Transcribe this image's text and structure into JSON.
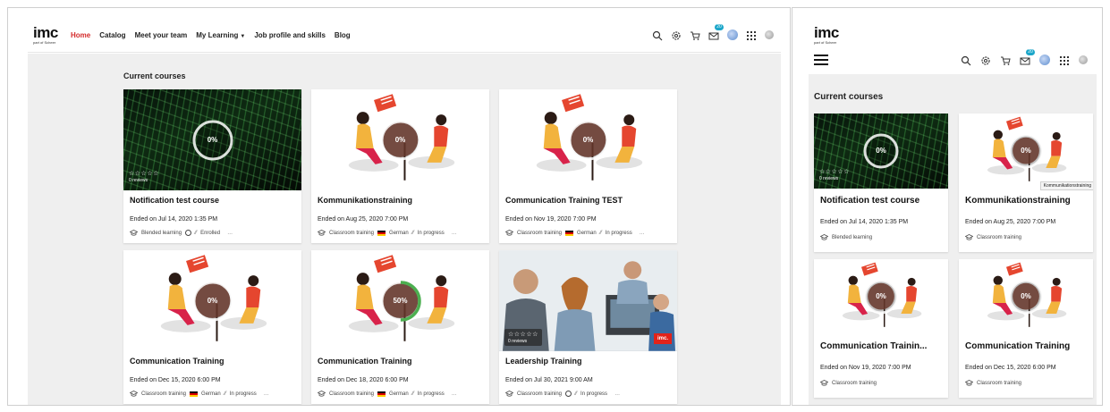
{
  "brand": {
    "logo": "imc",
    "logo_sub": "part of Scheer"
  },
  "nav": {
    "items": [
      {
        "label": "Home",
        "active": true
      },
      {
        "label": "Catalog"
      },
      {
        "label": "Meet your team"
      },
      {
        "label": "My Learning",
        "has_dropdown": true
      },
      {
        "label": "Job profile and skills"
      },
      {
        "label": "Blog"
      }
    ]
  },
  "toolbar": {
    "icons": [
      "search-icon",
      "settings-icon",
      "cart-icon",
      "mail-icon",
      "avatar",
      "apps-grid-icon",
      "profile-icon"
    ],
    "mail_badge": "20"
  },
  "colors": {
    "accent": "#d42b2b",
    "badge": "#1ba6c9",
    "page_bg": "#efefef",
    "progress_green": "#4caf50"
  },
  "section": {
    "title": "Current courses"
  },
  "courses": [
    {
      "title": "Notification test course",
      "ended": "Ended on Jul 14, 2020 1:35 PM",
      "type": "Blended learning",
      "language_icon": "globe-icon",
      "language": "",
      "status": "Enrolled",
      "progress": "0%",
      "progress_value": 0,
      "stars": "☆☆☆☆☆",
      "reviews": "0 reviews",
      "image": "matrix"
    },
    {
      "title": "Kommunikationstraining",
      "ended": "Ended on Aug 25, 2020 7:00 PM",
      "type": "Classroom training",
      "language_icon": "german-flag-icon",
      "language": "German",
      "status": "In progress",
      "progress": "0%",
      "progress_value": 0,
      "image": "illustration"
    },
    {
      "title": "Communication Training TEST",
      "ended": "Ended on Nov 19, 2020 7:00 PM",
      "type": "Classroom training",
      "language_icon": "german-flag-icon",
      "language": "German",
      "status": "In progress",
      "progress": "0%",
      "progress_value": 0,
      "image": "illustration"
    },
    {
      "title": "Communication Training",
      "ended": "Ended on Dec 15, 2020 6:00 PM",
      "type": "Classroom training",
      "language_icon": "german-flag-icon",
      "language": "German",
      "status": "In progress",
      "progress": "0%",
      "progress_value": 0,
      "image": "illustration"
    },
    {
      "title": "Communication Training",
      "ended": "Ended on Dec 18, 2020 6:00 PM",
      "type": "Classroom training",
      "language_icon": "german-flag-icon",
      "language": "German",
      "status": "In progress",
      "progress": "50%",
      "progress_value": 50,
      "image": "illustration"
    },
    {
      "title": "Leadership Training",
      "ended": "Ended on Jul 30, 2021 9:00 AM",
      "type": "Classroom training",
      "language_icon": "globe-icon",
      "language": "",
      "status": "In progress",
      "stars": "☆☆☆☆☆",
      "reviews": "0 reviews",
      "image": "photo",
      "imc_badge": "imc."
    }
  ],
  "mobile": {
    "section_title": "Current courses",
    "tooltip": "Kommunikationstraining",
    "courses": [
      {
        "title": "Notification test course",
        "ended": "Ended on Jul 14, 2020 1:35 PM",
        "type": "Blended learning",
        "progress": "0%",
        "stars": "☆☆☆☆☆",
        "reviews": "0 reviews"
      },
      {
        "title": "Kommunikationstraining",
        "ended": "Ended on Aug 25, 2020 7:00 PM",
        "type": "Classroom training",
        "progress": "0%"
      },
      {
        "title": "Communication Trainin...",
        "ended": "Ended on Nov 19, 2020 7:00 PM",
        "type": "Classroom training",
        "progress": "0%"
      },
      {
        "title": "Communication Training",
        "ended": "Ended on Dec 15, 2020 6:00 PM",
        "type": "Classroom training",
        "progress": "0%"
      }
    ]
  }
}
